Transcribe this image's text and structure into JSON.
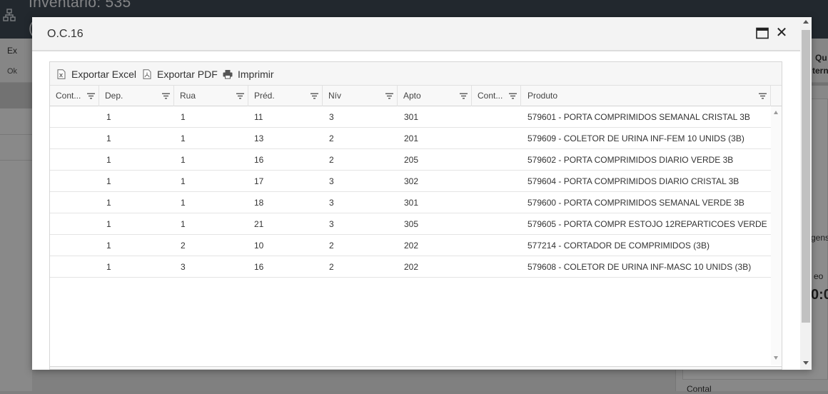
{
  "background": {
    "title": "Inventario: 535",
    "title_line2": "(",
    "toolbar_export": "Ex",
    "toolbar_ok": "Ok",
    "right_panel": {
      "t1": "Qu",
      "t2": "tern",
      "t3": "gens",
      "t4": "eo",
      "t5": "0:0",
      "t6": "Contal"
    }
  },
  "dialog": {
    "title": "O.C.16",
    "maximize_icon": "window-maximize-icon",
    "close_symbol": "✕"
  },
  "toolbar": {
    "export_excel": "Exportar Excel",
    "export_pdf": "Exportar PDF",
    "print": "Imprimir"
  },
  "columns": [
    {
      "key": "cont1",
      "label": "Cont..."
    },
    {
      "key": "dep",
      "label": "Dep."
    },
    {
      "key": "rua",
      "label": "Rua"
    },
    {
      "key": "pred",
      "label": "Préd."
    },
    {
      "key": "niv",
      "label": "Nív"
    },
    {
      "key": "apto",
      "label": "Apto"
    },
    {
      "key": "cont2",
      "label": "Cont..."
    },
    {
      "key": "produto",
      "label": "Produto"
    }
  ],
  "rows": [
    {
      "cont1": "",
      "dep": "1",
      "rua": "1",
      "pred": "11",
      "niv": "3",
      "apto": "301",
      "cont2": "",
      "produto": "579601 - PORTA COMPRIMIDOS SEMANAL CRISTAL 3B"
    },
    {
      "cont1": "",
      "dep": "1",
      "rua": "1",
      "pred": "13",
      "niv": "2",
      "apto": "201",
      "cont2": "",
      "produto": "579609 - COLETOR DE URINA INF-FEM 10 UNIDS (3B)"
    },
    {
      "cont1": "",
      "dep": "1",
      "rua": "1",
      "pred": "16",
      "niv": "2",
      "apto": "205",
      "cont2": "",
      "produto": "579602 - PORTA COMPRIMIDOS DIARIO VERDE 3B"
    },
    {
      "cont1": "",
      "dep": "1",
      "rua": "1",
      "pred": "17",
      "niv": "3",
      "apto": "302",
      "cont2": "",
      "produto": "579604 - PORTA COMPRIMIDOS DIARIO CRISTAL 3B"
    },
    {
      "cont1": "",
      "dep": "1",
      "rua": "1",
      "pred": "18",
      "niv": "3",
      "apto": "301",
      "cont2": "",
      "produto": "579600 - PORTA COMPRIMIDOS SEMANAL VERDE 3B"
    },
    {
      "cont1": "",
      "dep": "1",
      "rua": "1",
      "pred": "21",
      "niv": "3",
      "apto": "305",
      "cont2": "",
      "produto": "579605 - PORTA COMPR ESTOJO 12REPARTICOES VERDE"
    },
    {
      "cont1": "",
      "dep": "1",
      "rua": "2",
      "pred": "10",
      "niv": "2",
      "apto": "202",
      "cont2": "",
      "produto": "577214 - CORTADOR DE COMPRIMIDOS (3B)"
    },
    {
      "cont1": "",
      "dep": "1",
      "rua": "3",
      "pred": "16",
      "niv": "2",
      "apto": "202",
      "cont2": "",
      "produto": "579608 - COLETOR DE URINA INF-MASC 10 UNIDS (3B)"
    }
  ],
  "icons": {
    "excel": "excel-file-icon",
    "pdf": "pdf-file-icon",
    "print": "printer-icon",
    "filter": "filter-icon"
  },
  "colors": {
    "header_bg": "#3f4a55",
    "dialog_header_bg": "#f3f3f3",
    "grid_header_bg": "#f8f8f8",
    "text": "#333333"
  }
}
